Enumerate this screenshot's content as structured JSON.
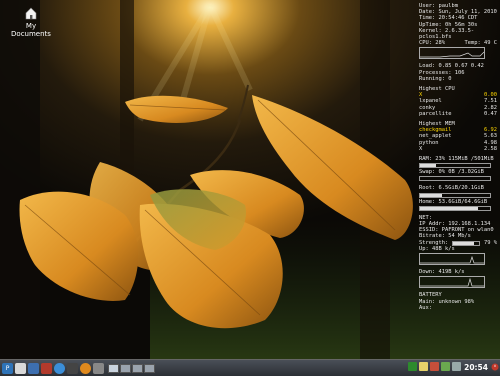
{
  "desktop": {
    "icon_label_line1": "My",
    "icon_label_line2": "Documents"
  },
  "conky": {
    "user": "User: paulbm",
    "date": "Date: Sun, July 11, 2010",
    "time": "Time: 20:54:46 CDT",
    "uptime": "UpTime: 0h 56m 30s",
    "kernel": "Kernel: 2.6.33.5-pclos1.bfs",
    "cpu": "CPU: 28%",
    "temp": "Temp: 49 C",
    "load": "Load: 0.85 0.67 0.42",
    "processes": "Processes: 106",
    "running": "Running: 0",
    "highest_cpu_title": "Highest CPU",
    "top_cpu": [
      {
        "name": "X",
        "value": "0.00"
      },
      {
        "name": "lxpanel",
        "value": "7.51"
      },
      {
        "name": "conky",
        "value": "2.82"
      },
      {
        "name": "parcellite",
        "value": "0.47"
      }
    ],
    "highest_mem_title": "Highest MEM",
    "top_mem": [
      {
        "name": "checkgmail",
        "value": "6.92"
      },
      {
        "name": "net_applet",
        "value": "5.63"
      },
      {
        "name": "python",
        "value": "4.98"
      },
      {
        "name": "X",
        "value": "2.58"
      }
    ],
    "ram": "RAM: 23% 115MiB /501MiB",
    "swap": "Swap: 0% 0B  /3.02GiB",
    "root": "Root: 6.5GiB/20.1GiB",
    "home": "Home: 53.6GiB/64.6GiB",
    "net_title": "NET:",
    "ip": "IP Addr: 192.168.1.134",
    "essid": "ESSID: PAFRONT on wlan0",
    "bitrate": "Bitrate: 54 Mb/s",
    "strength_label": "Strength:",
    "strength_value": "79 %",
    "up": "Up: 48B    k/s",
    "down": "Down: 419B   k/s",
    "battery_title": "BATTERY",
    "battery_main": "Main: unknown 98%",
    "battery_aux": "Aux:",
    "cpu_percent": 28,
    "ram_percent": 23,
    "swap_percent": 0,
    "strength_percent": 79
  },
  "taskbar": {
    "clock": "20:54"
  }
}
